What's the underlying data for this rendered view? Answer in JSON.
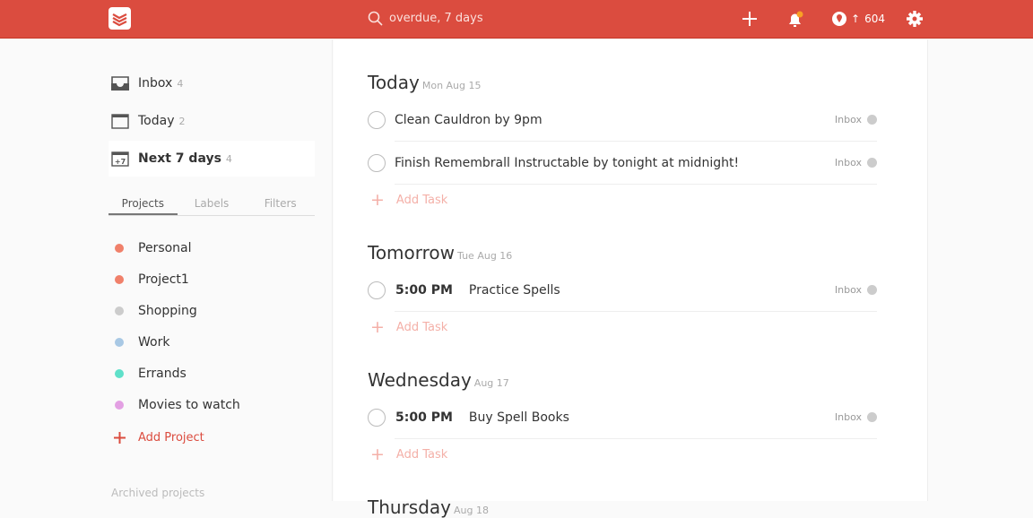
{
  "header": {
    "search_placeholder": "overdue, 7 days",
    "karma": "604",
    "notification_color": "#f9a025"
  },
  "nav": [
    {
      "label": "Inbox",
      "count": "4"
    },
    {
      "label": "Today",
      "count": "2"
    },
    {
      "label": "Next 7 days",
      "count": "4"
    }
  ],
  "tabs": [
    "Projects",
    "Labels",
    "Filters"
  ],
  "projects": [
    {
      "name": "Personal",
      "color": "#f0806a"
    },
    {
      "name": "Project1",
      "color": "#f0806a"
    },
    {
      "name": "Shopping",
      "color": "#cccccc"
    },
    {
      "name": "Work",
      "color": "#a8c8e4"
    },
    {
      "name": "Errands",
      "color": "#5fe0c9"
    },
    {
      "name": "Movies to watch",
      "color": "#e3a0e3"
    }
  ],
  "add_project": "Add Project",
  "archived": "Archived projects",
  "days": [
    {
      "name": "Today",
      "date": "Mon Aug 15",
      "tasks": [
        {
          "time": "",
          "text": "Clean Cauldron by 9pm",
          "project": "Inbox"
        },
        {
          "time": "",
          "text": "Finish Remembrall Instructable by tonight at midnight!",
          "project": "Inbox"
        }
      ]
    },
    {
      "name": "Tomorrow",
      "date": "Tue Aug 16",
      "tasks": [
        {
          "time": "5:00 PM",
          "text": "Practice Spells",
          "project": "Inbox"
        }
      ]
    },
    {
      "name": "Wednesday",
      "date": "Aug 17",
      "tasks": [
        {
          "time": "5:00 PM",
          "text": "Buy Spell Books",
          "project": "Inbox"
        }
      ]
    },
    {
      "name": "Thursday",
      "date": "Aug 18",
      "tasks": []
    }
  ],
  "add_task": "Add Task"
}
